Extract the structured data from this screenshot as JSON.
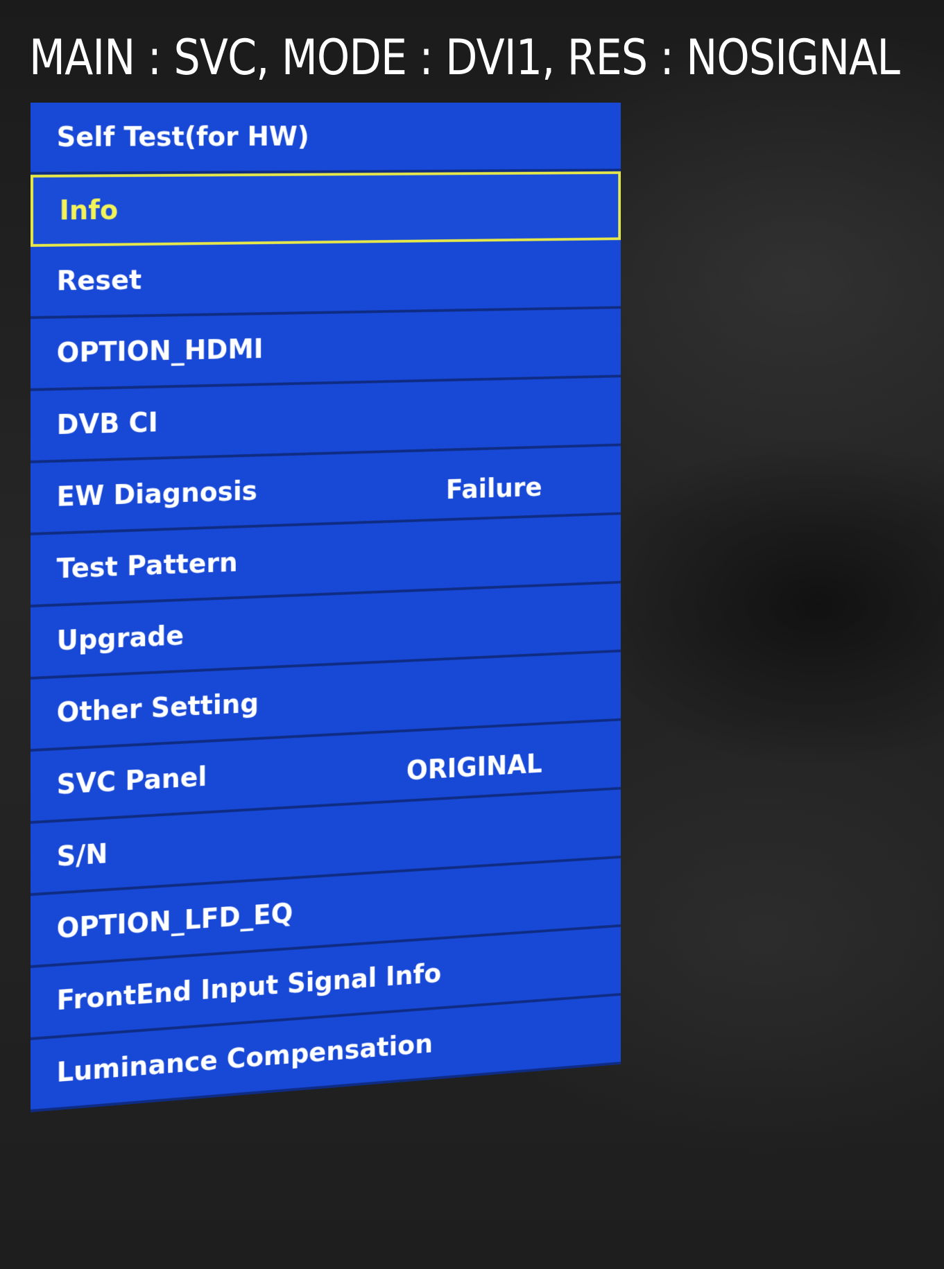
{
  "header": {
    "title": "MAIN : SVC, MODE : DVI1, RES : NOSIGNAL"
  },
  "menu": {
    "items": [
      {
        "label": "Self Test(for HW)",
        "value": ""
      },
      {
        "label": "Info",
        "value": ""
      },
      {
        "label": "Reset",
        "value": ""
      },
      {
        "label": "OPTION_HDMI",
        "value": ""
      },
      {
        "label": "DVB CI",
        "value": ""
      },
      {
        "label": "EW Diagnosis",
        "value": "Failure"
      },
      {
        "label": "Test Pattern",
        "value": ""
      },
      {
        "label": "Upgrade",
        "value": ""
      },
      {
        "label": "Other Setting",
        "value": ""
      },
      {
        "label": "SVC Panel",
        "value": "ORIGINAL"
      },
      {
        "label": "S/N",
        "value": ""
      },
      {
        "label": "OPTION_LFD_EQ",
        "value": ""
      },
      {
        "label": "FrontEnd Input Signal Info",
        "value": ""
      },
      {
        "label": "Luminance Compensation",
        "value": ""
      }
    ],
    "selected_index": 1
  },
  "colors": {
    "menu_bg": "#1848d6",
    "selection_border": "#e6e84a",
    "selection_text": "#f2f25a",
    "text": "#ffffff",
    "screen_bg": "#222222"
  }
}
